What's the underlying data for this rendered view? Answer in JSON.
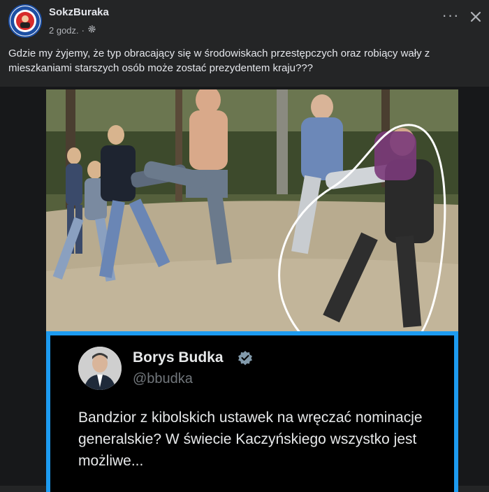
{
  "post": {
    "author": "SokzBuraka",
    "time": "2 godz.",
    "privacy_icon": "gear-icon",
    "text": "Gdzie my żyjemy, że typ obracający się w środowiskach przestępczych oraz robiący wały z mieszkaniami starszych osób może zostać prezydentem kraju???"
  },
  "header_actions": {
    "more_icon": "more-options-icon",
    "more_glyph": "···",
    "close_icon": "close-icon"
  },
  "tweet": {
    "name": "Borys Budka",
    "handle": "@bbudka",
    "verified_icon": "verified-badge-icon",
    "text": "Bandzior z kibolskich ustawek na wręczać nominacje generalskie? W świecie Kaczyńskiego wszystko jest możliwe..."
  },
  "colors": {
    "background": "#242526",
    "tweet_border": "#1d9bf0",
    "secondary_text": "#b0b3b8"
  }
}
